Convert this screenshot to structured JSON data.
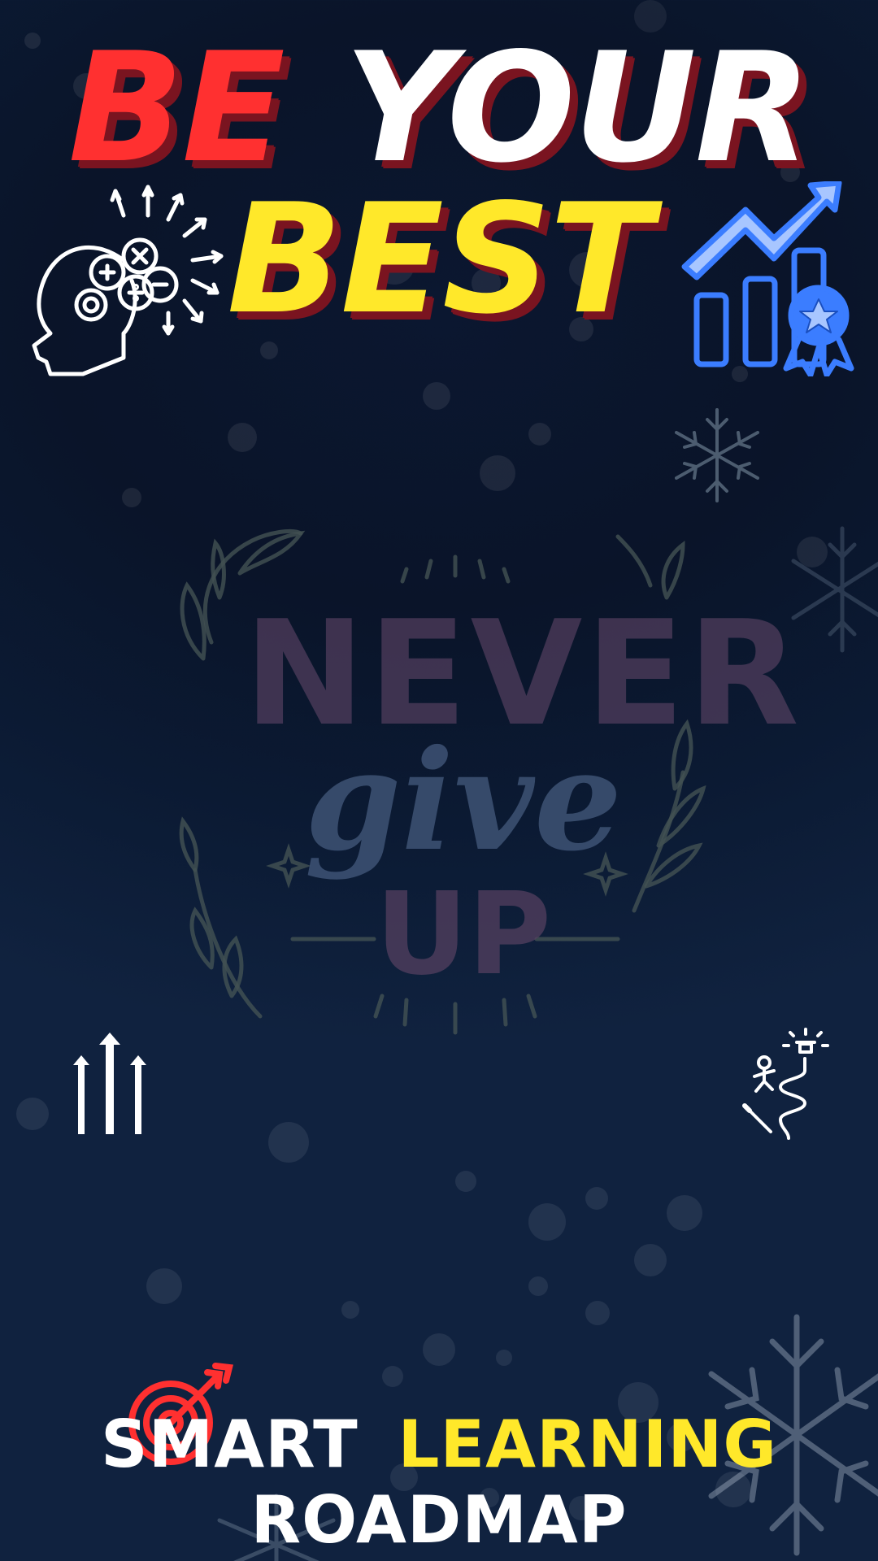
{
  "header": {
    "be": "BE",
    "your": "YOUR",
    "best": "BEST"
  },
  "center": {
    "never": "NEVER",
    "give": "give",
    "up": "UP"
  },
  "footer": {
    "smart": "SMART",
    "learning": "LEARNING",
    "roadmap": "ROADMAP"
  },
  "icons": {
    "mind": "mind-icon",
    "growth": "growth-chart-icon",
    "up_arrows": "up-arrows-icon",
    "journey": "journey-icon",
    "snowflake": "snowflake-icon",
    "target": "target-icon"
  },
  "colors": {
    "red": "#ff3030",
    "yellow": "#ffe82a",
    "white": "#ffffff",
    "blue": "#3b7dff",
    "bg": "#0b1730"
  }
}
